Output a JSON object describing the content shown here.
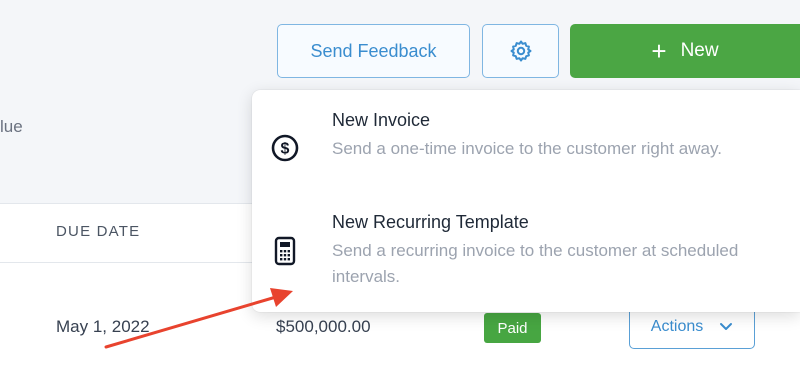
{
  "header": {
    "partial_label": "lue",
    "send_feedback_label": "Send Feedback",
    "settings_icon": "gear-icon",
    "new_button": {
      "icon": "plus-icon",
      "label": "New"
    }
  },
  "dropdown": {
    "items": [
      {
        "icon": "dollar-circle-icon",
        "title": "New Invoice",
        "description": "Send a one-time invoice to the customer right away."
      },
      {
        "icon": "calculator-icon",
        "title": "New Recurring Template",
        "description": "Send a recurring invoice to the customer at scheduled intervals."
      }
    ]
  },
  "table": {
    "columns": [
      "DUE DATE"
    ],
    "rows": [
      {
        "due_date": "May 1, 2022",
        "amount": "$500,000.00",
        "status": "Paid",
        "actions_label": "Actions"
      }
    ]
  },
  "colors": {
    "primary_green": "#4ba644",
    "accent_blue": "#3a8dcf",
    "annotation_arrow": "#e8432e"
  }
}
